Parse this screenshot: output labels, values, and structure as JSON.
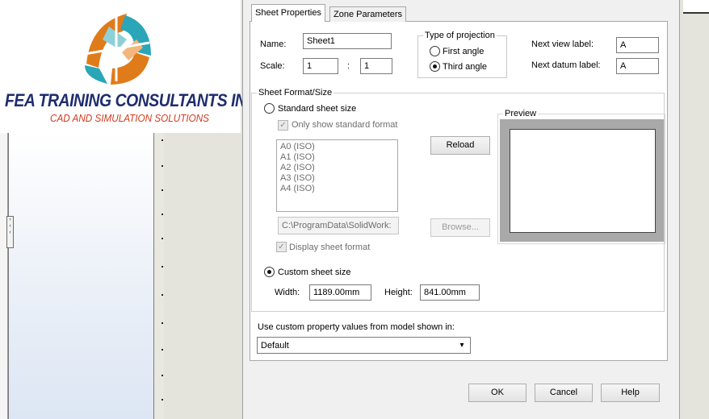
{
  "logo": {
    "title": "FEA TRAINING  CONSULTANTS INC.",
    "subtitle": "CAD AND SIMULATION SOLUTIONS"
  },
  "tabs": [
    {
      "label": "Sheet Properties",
      "active": true
    },
    {
      "label": "Zone Parameters",
      "active": false
    }
  ],
  "sheet": {
    "name_label": "Name:",
    "name_value": "Sheet1",
    "scale_label": "Scale:",
    "scale_num": "1",
    "scale_sep": ":",
    "scale_den": "1"
  },
  "projection": {
    "title": "Type of projection",
    "first_angle": "First angle",
    "third_angle": "Third angle",
    "selected": "third"
  },
  "labels": {
    "next_view_label": "Next view label:",
    "next_view_value": "A",
    "next_datum_label": "Next datum label:",
    "next_datum_value": "A"
  },
  "format": {
    "title": "Sheet Format/Size",
    "standard_label": "Standard sheet size",
    "only_standard": "Only show standard format",
    "sizes": [
      "A0 (ISO)",
      "A1 (ISO)",
      "A2 (ISO)",
      "A3 (ISO)",
      "A4 (ISO)"
    ],
    "reload": "Reload",
    "path_value": "C:\\ProgramData\\SolidWork:",
    "browse": "Browse...",
    "display_format": "Display sheet format",
    "custom_label": "Custom sheet size",
    "width_label": "Width:",
    "width_value": "1189.00mm",
    "height_label": "Height:",
    "height_value": "841.00mm",
    "preview_title": "Preview"
  },
  "model": {
    "label": "Use custom property values from model shown in:",
    "selected": "Default"
  },
  "buttons": {
    "ok": "OK",
    "cancel": "Cancel",
    "help": "Help"
  },
  "colors": {
    "logo_title": "#1f2d6e",
    "logo_subtitle": "#d03a1c",
    "logo_orange": "#e07b1a",
    "logo_teal": "#2aa6b8"
  }
}
